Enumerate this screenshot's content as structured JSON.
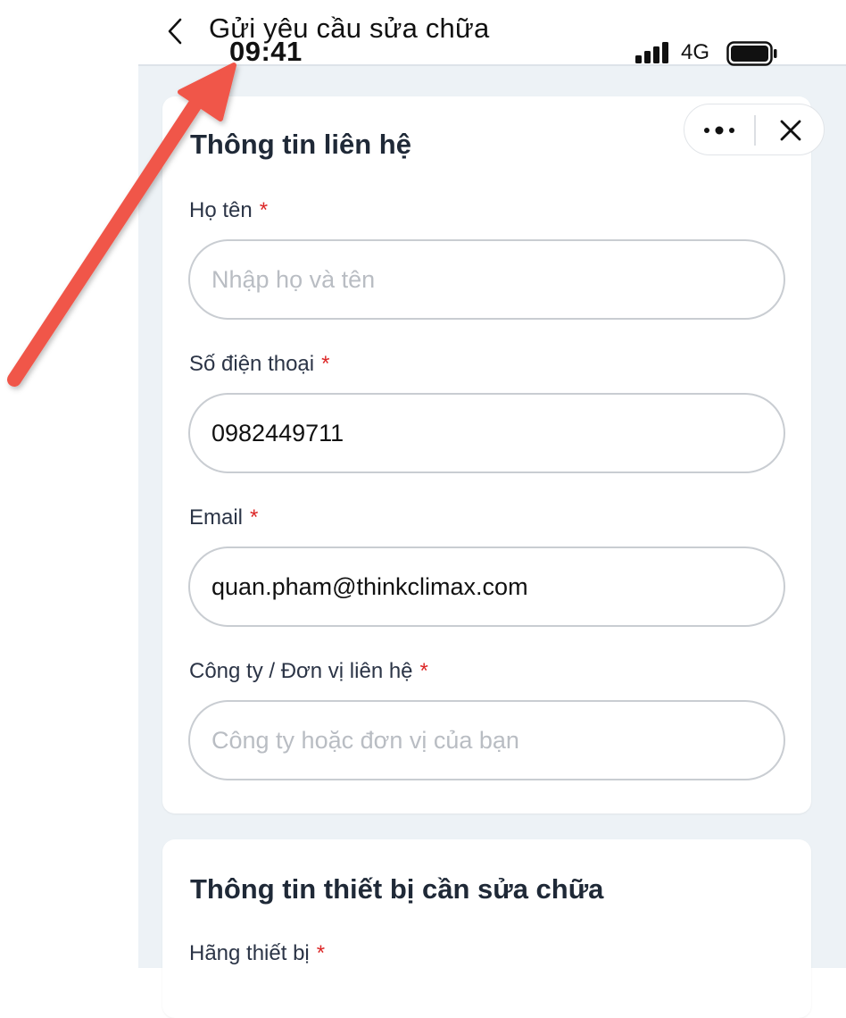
{
  "header": {
    "title": "Gửi yêu cầu sửa chữa",
    "back_icon": "chevron-left-icon"
  },
  "status_bar": {
    "time": "09:41",
    "network": "4G",
    "signal_icon": "cellular-signal-icon",
    "battery_icon": "battery-icon"
  },
  "capsule": {
    "more_icon": "more-dots-icon",
    "close_icon": "close-icon"
  },
  "contact_section": {
    "title": "Thông tin liên hệ",
    "fields": [
      {
        "label": "Họ tên",
        "required": "*",
        "value": "",
        "placeholder": "Nhập họ và tên"
      },
      {
        "label": "Số điện thoại",
        "required": "*",
        "value": "0982449711",
        "placeholder": ""
      },
      {
        "label": "Email",
        "required": "*",
        "value": "quan.pham@thinkclimax.com",
        "placeholder": ""
      },
      {
        "label": "Công ty / Đơn vị liên hệ",
        "required": "*",
        "value": "",
        "placeholder": "Công ty hoặc đơn vị của bạn"
      }
    ]
  },
  "device_section": {
    "title": "Thông tin thiết bị cần sửa chữa",
    "fields": [
      {
        "label": "Hãng thiết bị",
        "required": "*"
      }
    ]
  },
  "annotation": {
    "arrow_icon": "red-arrow-annotation",
    "color": "#f0564a"
  },
  "colors": {
    "background": "#edf2f6",
    "card": "#ffffff",
    "required": "#dc2626",
    "input_border": "#c9cdd2",
    "placeholder": "#b9bdc3"
  }
}
